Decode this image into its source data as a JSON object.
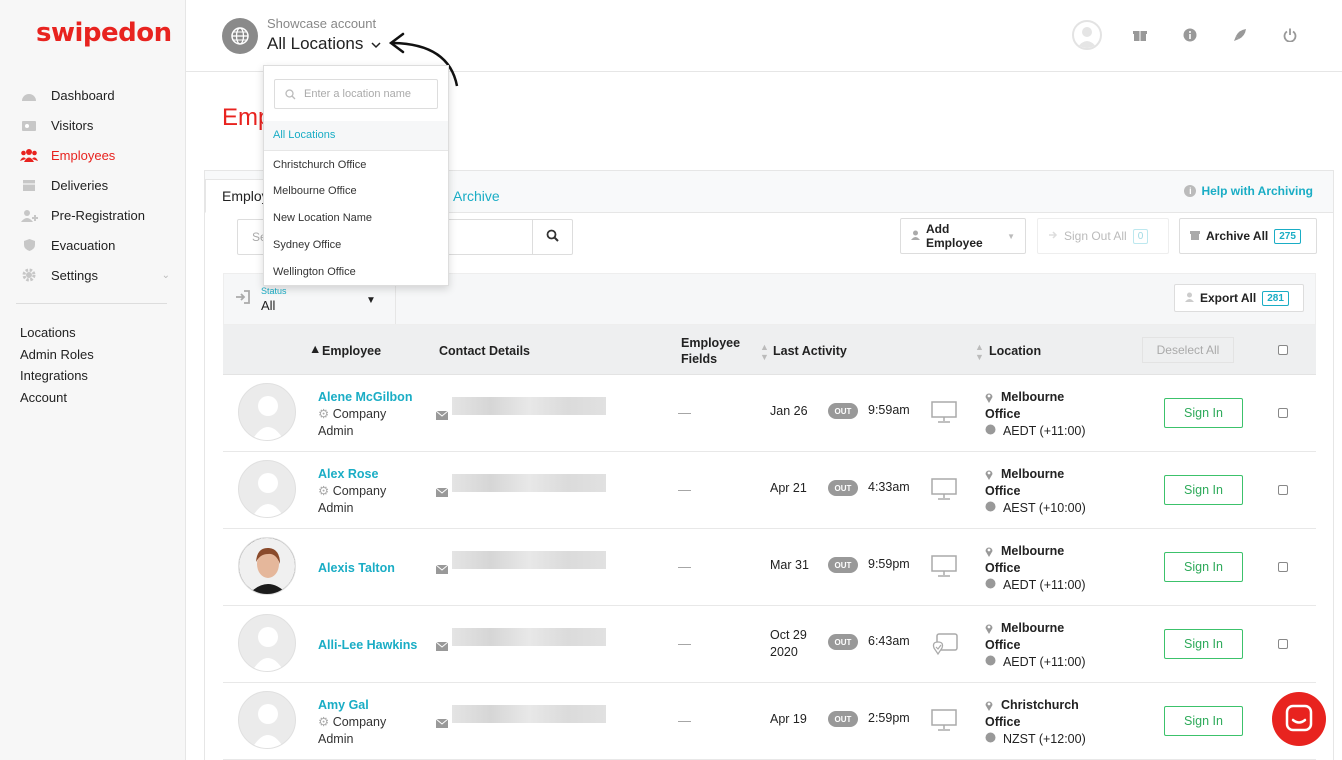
{
  "brand": {
    "logo": "swipedon",
    "accent": "#e8231f",
    "link": "#1aadc5",
    "success": "#2eaa5a"
  },
  "sidebar": {
    "items": [
      {
        "label": "Dashboard",
        "icon": "dashboard-icon"
      },
      {
        "label": "Visitors",
        "icon": "visitors-icon"
      },
      {
        "label": "Employees",
        "icon": "employees-icon",
        "active": true
      },
      {
        "label": "Deliveries",
        "icon": "deliveries-icon"
      },
      {
        "label": "Pre-Registration",
        "icon": "pre-registration-icon"
      },
      {
        "label": "Evacuation",
        "icon": "shield-icon"
      },
      {
        "label": "Settings",
        "icon": "gear-icon"
      }
    ],
    "links": [
      "Locations",
      "Admin Roles",
      "Integrations",
      "Account"
    ]
  },
  "header": {
    "account": "Showcase account",
    "location": "All Locations"
  },
  "dropdown": {
    "placeholder": "Enter a location name",
    "all": "All Locations",
    "options": [
      "Christchurch Office",
      "Melbourne Office",
      "New Location Name",
      "Sydney Office",
      "Wellington Office"
    ]
  },
  "page": {
    "title": "Emp"
  },
  "tabs": {
    "employees": "Employ",
    "archive": "Archive",
    "help": "Help with Archiving"
  },
  "search": {
    "placeholder": "Se"
  },
  "toolbar": {
    "add": "Add Employee",
    "signout": "Sign Out All",
    "signout_count": "0",
    "archive": "Archive All",
    "archive_count": "275",
    "export": "Export All",
    "export_count": "281"
  },
  "filter": {
    "label": "Status",
    "value": "All"
  },
  "table": {
    "headers": {
      "employee": "Employee",
      "contact": "Contact Details",
      "fields_1": "Employee",
      "fields_2": "Fields",
      "activity": "Last Activity",
      "location": "Location",
      "deselect": "Deselect All"
    },
    "rows": [
      {
        "name": "Alene McGilbon",
        "role_1": "Company",
        "role_2": "Admin",
        "fields": "—",
        "date_1": "Jan 26",
        "date_2": "",
        "status": "OUT",
        "time": "9:59am",
        "device": "desktop",
        "loc_1": "Melbourne",
        "loc_2": "Office",
        "tz": "AEDT (+11:00)",
        "action": "Sign In"
      },
      {
        "name": "Alex Rose",
        "role_1": "Company",
        "role_2": "Admin",
        "fields": "—",
        "date_1": "Apr 21",
        "date_2": "",
        "status": "OUT",
        "time": "4:33am",
        "device": "desktop",
        "loc_1": "Melbourne",
        "loc_2": "Office",
        "tz": "AEST (+10:00)",
        "action": "Sign In"
      },
      {
        "name": "Alexis Talton",
        "role_1": "",
        "role_2": "",
        "fields": "—",
        "date_1": "Mar 31",
        "date_2": "",
        "status": "OUT",
        "time": "9:59pm",
        "device": "desktop",
        "loc_1": "Melbourne",
        "loc_2": "Office",
        "tz": "AEDT (+11:00)",
        "action": "Sign In"
      },
      {
        "name": "Alli-Lee Hawkins",
        "role_1": "",
        "role_2": "",
        "fields": "—",
        "date_1": "Oct 29",
        "date_2": "2020",
        "status": "OUT",
        "time": "6:43am",
        "device": "tablet",
        "loc_1": "Melbourne",
        "loc_2": "Office",
        "tz": "AEDT (+11:00)",
        "action": "Sign In"
      },
      {
        "name": "Amy Gal",
        "role_1": "Company",
        "role_2": "Admin",
        "fields": "—",
        "date_1": "Apr 19",
        "date_2": "",
        "status": "OUT",
        "time": "2:59pm",
        "device": "desktop",
        "loc_1": "Christchurch",
        "loc_2": "Office",
        "tz": "NZST (+12:00)",
        "action": "Sign In"
      }
    ]
  }
}
